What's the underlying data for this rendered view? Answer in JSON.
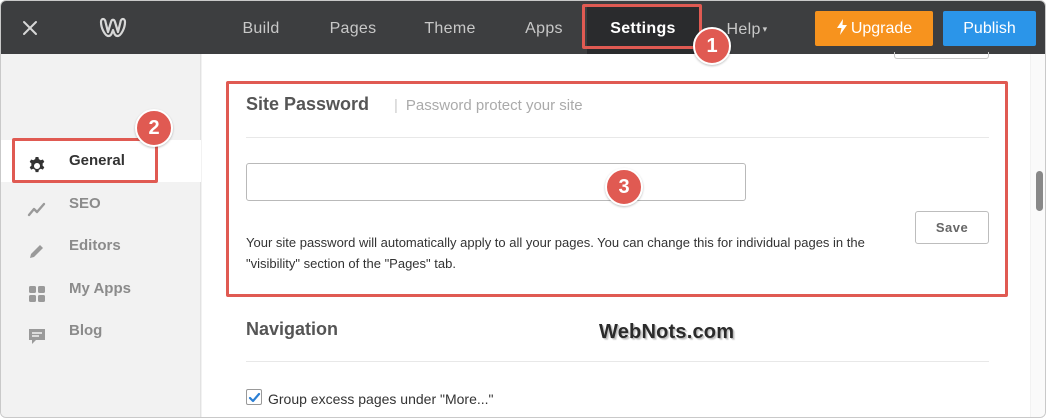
{
  "topbar": {
    "close_icon": "close-icon",
    "logo_icon": "weebly-logo-icon",
    "nav": {
      "build": "Build",
      "pages": "Pages",
      "theme": "Theme",
      "apps": "Apps",
      "settings": "Settings",
      "help": "Help"
    },
    "upgrade_label": "Upgrade",
    "upgrade_icon": "lightning-icon",
    "publish_label": "Publish",
    "upgrade_color": "#f7931e",
    "publish_color": "#2b95e9"
  },
  "sidebar": {
    "items": [
      {
        "label": "General",
        "icon": "gear-icon",
        "active": true
      },
      {
        "label": "SEO",
        "icon": "trend-icon",
        "active": false
      },
      {
        "label": "Editors",
        "icon": "pencil-icon",
        "active": false
      },
      {
        "label": "My Apps",
        "icon": "grid-icon",
        "active": false
      },
      {
        "label": "Blog",
        "icon": "chat-icon",
        "active": false
      }
    ]
  },
  "main": {
    "site_password": {
      "title": "Site Password",
      "subtitle": "Password protect your site",
      "input_value": "",
      "save_label": "Save",
      "help_text": "Your site password will automatically apply to all your pages. You can change this for individual pages in the \"visibility\" section of the \"Pages\" tab."
    },
    "navigation": {
      "title": "Navigation",
      "group_label": "Group excess pages under \"More...\"",
      "group_checked": true
    }
  },
  "annotations": {
    "badge_1": "1",
    "badge_2": "2",
    "badge_3": "3",
    "highlight_color": "#e05a52"
  },
  "watermark": "WebNots.com"
}
